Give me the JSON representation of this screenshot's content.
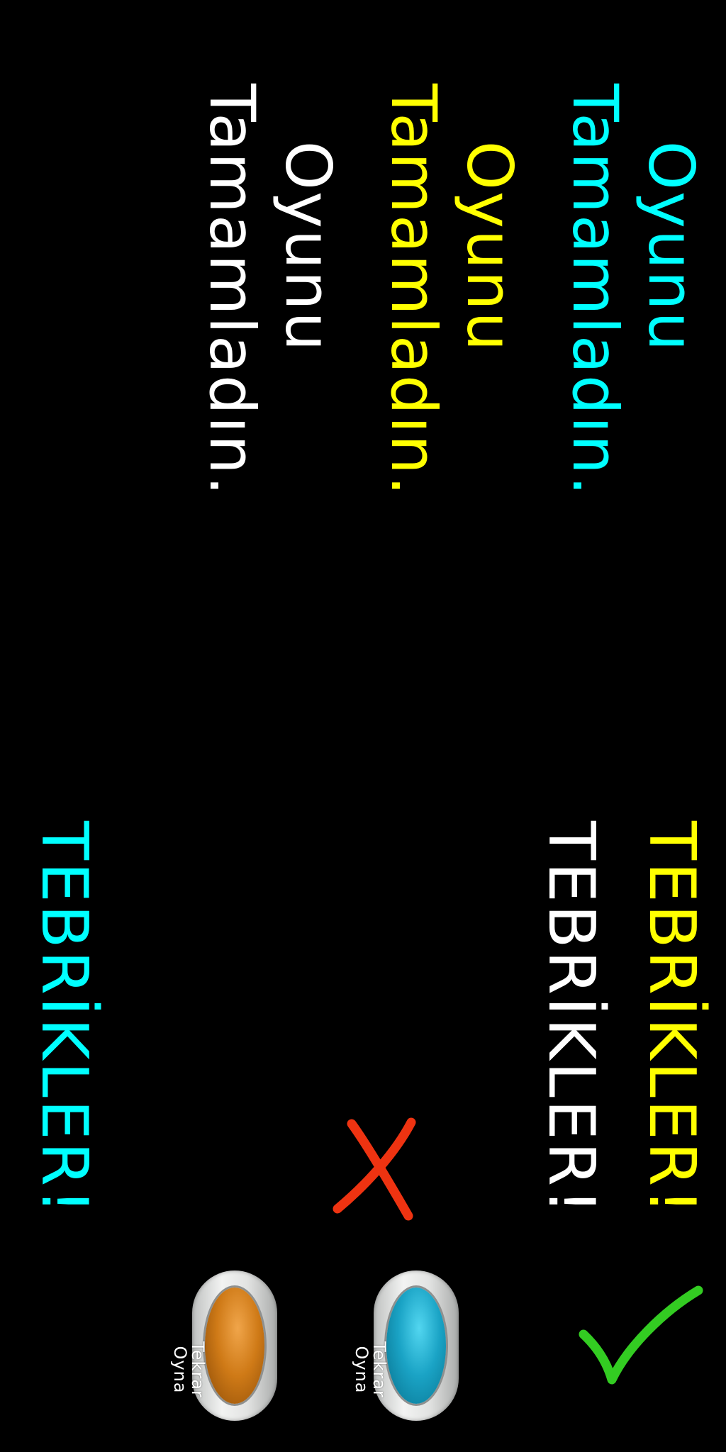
{
  "completed_messages": [
    {
      "line1": "Oyunu",
      "line2": "Tamamladın.",
      "color": "#00ffff"
    },
    {
      "line1": "Oyunu",
      "line2": "Tamamladın.",
      "color": "#ffff00"
    },
    {
      "line1": "Oyunu",
      "line2": "Tamamladın.",
      "color": "#ffffff"
    }
  ],
  "congrats": [
    {
      "text": "TEBRİKLER!",
      "color": "#ffff00"
    },
    {
      "text": "TEBRİKLER!",
      "color": "#ffffff"
    },
    {
      "text": "TEBRİKLER!",
      "color": "#00ffff"
    }
  ],
  "icons": {
    "check": {
      "name": "check-icon",
      "color": "#33cc22"
    },
    "cross": {
      "name": "close-icon",
      "color": "#ee3311"
    }
  },
  "buttons": [
    {
      "line1": "Tekrar",
      "line2": "Oyna",
      "color": "#1aa3c5"
    },
    {
      "line1": "Tekrar",
      "line2": "Oyna",
      "color": "#cf7a17"
    }
  ]
}
